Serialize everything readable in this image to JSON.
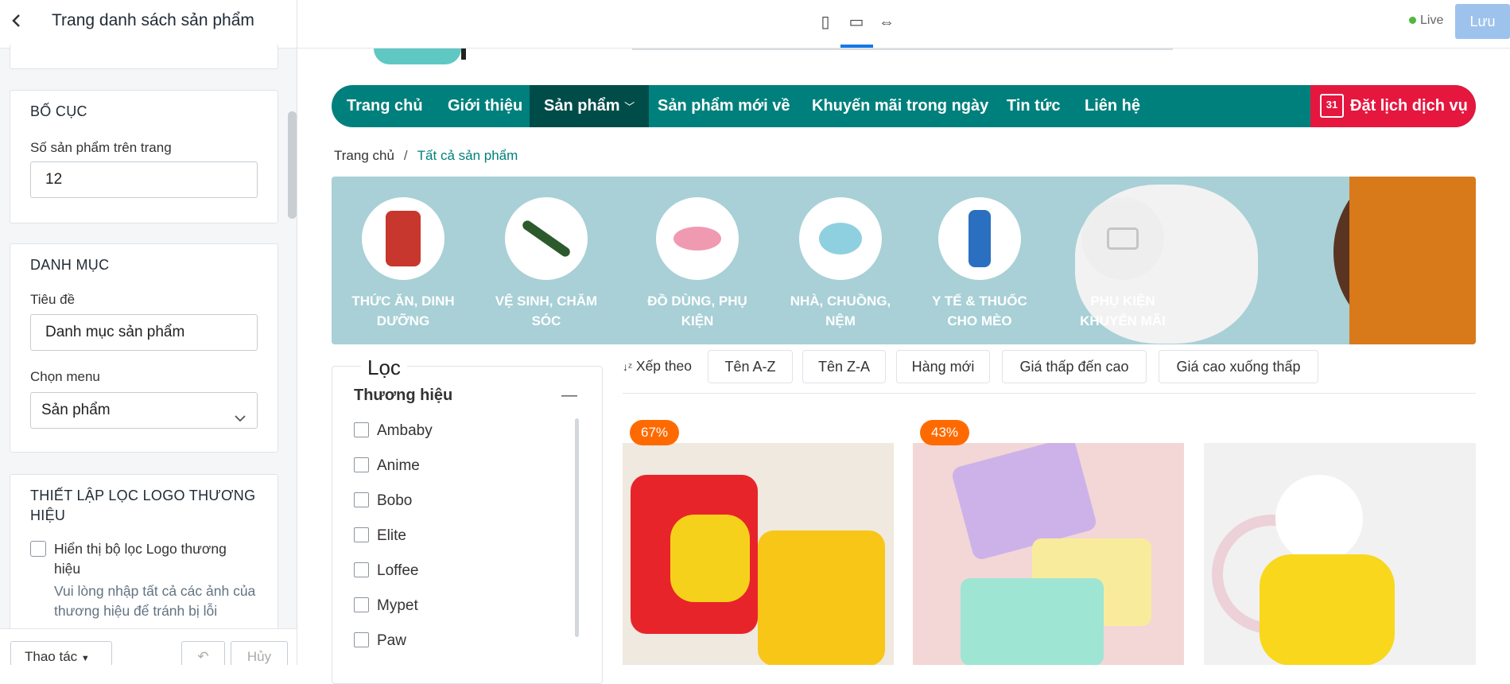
{
  "sidebar": {
    "title": "Trang danh sách sản phẩm",
    "layout": {
      "heading": "BỐ CỤC",
      "per_page_label": "Số sản phẩm trên trang",
      "per_page_value": "12"
    },
    "category": {
      "heading": "DANH MỤC",
      "title_label": "Tiêu đề",
      "title_value": "Danh mục sản phẩm",
      "menu_label": "Chọn menu",
      "menu_value": "Sản phẩm"
    },
    "brand_logo": {
      "heading": "THIẾT LẬP LỌC LOGO THƯƠNG HIỆU",
      "checkbox_label": "Hiển thị bộ lọc Logo thương hiệu",
      "hint": "Vui lòng nhập tất cả các ảnh của thương hiệu để tránh bị lỗi"
    },
    "footer": {
      "actions_label": "Thao tác",
      "cancel_label": "Hủy"
    }
  },
  "topbar": {
    "live_label": "Live",
    "save_label": "Lưu"
  },
  "nav": {
    "items": [
      "Trang chủ",
      "Giới thiệu",
      "Sản phẩm",
      "Sản phẩm mới về",
      "Khuyến mãi trong ngày",
      "Tin tức",
      "Liên hệ"
    ],
    "booking_label": "Đặt lịch dịch vụ",
    "booking_day": "31"
  },
  "breadcrumb": {
    "home": "Trang chủ",
    "sep": "/",
    "current": "Tất cả sản phẩm"
  },
  "categories": [
    "THỨC ĂN, DINH DƯỠNG",
    "VỆ SINH, CHĂM SÓC",
    "ĐỒ DÙNG, PHỤ KIỆN",
    "NHÀ, CHUỒNG, NỆM",
    "Y TẾ & THUỐC CHO MÈO",
    "PHỤ KIỆN KHUYẾN MÃI"
  ],
  "filter": {
    "title": "Lọc",
    "brand_heading": "Thương hiệu",
    "brands": [
      "Ambaby",
      "Anime",
      "Bobo",
      "Elite",
      "Loffee",
      "Mypet",
      "Paw"
    ]
  },
  "sort": {
    "label": "Xếp theo",
    "options": [
      "Tên A-Z",
      "Tên Z-A",
      "Hàng mới",
      "Giá thấp đến cao",
      "Giá cao xuống thấp"
    ]
  },
  "products": [
    {
      "discount": "67%"
    },
    {
      "discount": "43%"
    },
    {
      "discount": ""
    }
  ],
  "colors": {
    "brand": "#00807c",
    "nav_active": "#004c49",
    "booking": "#e5173f",
    "badge": "#ff6a00",
    "save": "#9dc3ec"
  }
}
